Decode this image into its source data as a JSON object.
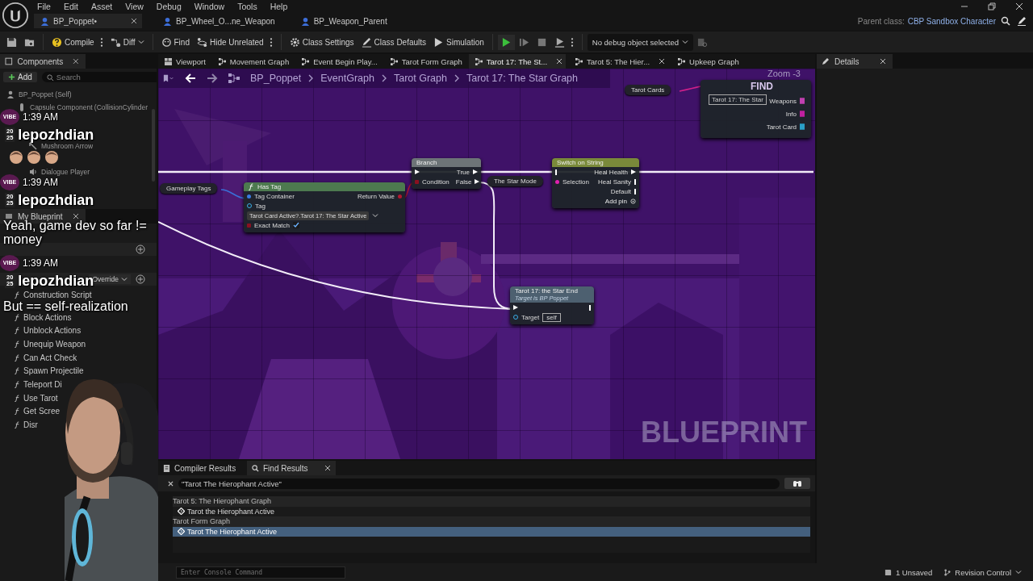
{
  "menu": [
    "File",
    "Edit",
    "Asset",
    "View",
    "Debug",
    "Window",
    "Tools",
    "Help"
  ],
  "asset_tabs": [
    {
      "label": "BP_Poppet•",
      "selected": true,
      "closable": true
    },
    {
      "label": "BP_Wheel_O...ne_Weapon",
      "selected": false,
      "closable": false
    },
    {
      "label": "BP_Weapon_Parent",
      "selected": false,
      "closable": false
    }
  ],
  "parent_class": {
    "label": "Parent class:",
    "value": "CBP Sandbox Character"
  },
  "toolbar": [
    {
      "kind": "save"
    },
    {
      "kind": "browse"
    },
    {
      "kind": "compile",
      "label": "Compile",
      "has_menu": true
    },
    {
      "kind": "diff",
      "label": "Diff"
    },
    {
      "kind": "find",
      "label": "Find"
    },
    {
      "kind": "hide",
      "label": "Hide Unrelated",
      "has_menu": true
    },
    {
      "kind": "settings",
      "label": "Class Settings"
    },
    {
      "kind": "defaults",
      "label": "Class Defaults"
    },
    {
      "kind": "simulation",
      "label": "Simulation"
    },
    {
      "kind": "play",
      "disabled": false
    },
    {
      "kind": "step",
      "disabled": true
    },
    {
      "kind": "stop",
      "disabled": true
    },
    {
      "kind": "eject",
      "disabled": true,
      "has_menu": true
    }
  ],
  "debug_object": "No debug object selected",
  "components": {
    "title": "Components",
    "add": "Add",
    "placeholder": "Search",
    "items": [
      {
        "label": "BP_Poppet (Self)",
        "kind": "self"
      },
      {
        "label": "Capsule Component (CollisionCylinder",
        "kind": "capsule"
      },
      {
        "label": "Mushroom Arrow",
        "kind": "arrow"
      },
      {
        "label": "Dialogue Player",
        "kind": "audio"
      }
    ]
  },
  "my_blueprint": {
    "title": "My Blueprint",
    "override": "Override",
    "functions": [
      "Construction Script",
      "Block Actions",
      "Unblock Actions",
      "Unequip Weapon",
      "Can Act Check",
      "Spawn Projectile",
      "Teleport Di",
      "Use Tarot",
      "Get Scree",
      "Disr"
    ]
  },
  "chat": [
    {
      "badge": "VIBE",
      "time": "1:39 AM",
      "year_badge": [
        "20",
        "25"
      ],
      "user": "lepozhdian",
      "kind": "emotes",
      "emotes": [
        {
          "kind": "emote"
        },
        {
          "kind": "emote"
        },
        {
          "kind": "emote"
        }
      ]
    },
    {
      "badge": "VIBE",
      "time": "1:39 AM",
      "year_badge": [
        "20",
        "25"
      ],
      "user": "lepozhdian",
      "kind": "text",
      "text": "Yeah, game dev so far != money"
    },
    {
      "badge": "VIBE",
      "time": "1:39 AM",
      "year_badge": [
        "20",
        "25"
      ],
      "user": "lepozhdian",
      "kind": "text",
      "text": "But == self-realization"
    }
  ],
  "graph_tabs": [
    {
      "label": "Viewport",
      "selected": false,
      "closable": false,
      "kind": "viewport"
    },
    {
      "label": "Movement Graph",
      "selected": false,
      "closable": false,
      "kind": "graph"
    },
    {
      "label": "Event Begin Play...",
      "selected": false,
      "closable": false,
      "kind": "graph"
    },
    {
      "label": "Tarot Form Graph",
      "selected": false,
      "closable": false,
      "kind": "graph"
    },
    {
      "label": "Tarot 17: The St...",
      "selected": true,
      "closable": true,
      "kind": "graph"
    },
    {
      "label": "Tarot 5: The Hier...",
      "selected": false,
      "closable": true,
      "kind": "graph"
    },
    {
      "label": "Upkeep Graph",
      "selected": false,
      "closable": false,
      "kind": "graph"
    }
  ],
  "breadcrumb": [
    "BP_Poppet",
    "EventGraph",
    "Tarot Graph",
    "Tarot 17: The Star Graph"
  ],
  "graph": {
    "zoom": "Zoom -3",
    "corner_label": "BLUEPRINT",
    "tarot_cards_var": "Tarot Cards",
    "gameplay_tags_var": "Gameplay Tags",
    "star_mode_var": "The Star Mode",
    "has_tag": {
      "title": "Has Tag",
      "tag_container": "Tag Container",
      "return_value": "Return Value",
      "tag": "Tag",
      "tag_value": "Tarot Card Active?.Tarot 17: The Star Active",
      "exact_match": "Exact Match",
      "exact_match_checked": true
    },
    "branch": {
      "title": "Branch",
      "true_pin": "True",
      "condition": "Condition",
      "false_pin": "False"
    },
    "switch": {
      "title": "Switch on String",
      "selection": "Selection",
      "outputs": [
        "Heal Health",
        "Heal Sanity",
        "Default"
      ],
      "add_pin": "Add pin"
    },
    "star_end": {
      "title": "Tarot 17: the Star End",
      "subtitle": "Target is BP Poppet",
      "target": "Target",
      "target_value": "self"
    },
    "widget_node": {
      "find": "FIND",
      "input": "Tarot 17: The Star",
      "outputs": [
        {
          "label": "Weapons",
          "color": "#c040b0"
        },
        {
          "label": "Info",
          "color": "#c020a0"
        },
        {
          "label": "Tarot Card",
          "color": "#2aa0c8"
        }
      ]
    }
  },
  "details": {
    "title": "Details"
  },
  "find_panel": {
    "tabs": [
      {
        "label": "Compiler Results",
        "selected": false,
        "closable": false
      },
      {
        "label": "Find Results",
        "selected": true,
        "closable": true
      }
    ],
    "query": "\"Tarot The Hierophant Active\"",
    "groups": [
      {
        "title": "Tarot 5: The Hierophant Graph",
        "results": [
          {
            "label": "Tarot the Hierophant Active",
            "selected": false
          }
        ]
      },
      {
        "title": "Tarot Form Graph",
        "results": [
          {
            "label": "Tarot The Hierophant Active",
            "selected": true
          }
        ]
      }
    ]
  },
  "status": {
    "console_placeholder": "Enter Console Command",
    "unsaved": "1 Unsaved",
    "revision": "Revision Control"
  }
}
